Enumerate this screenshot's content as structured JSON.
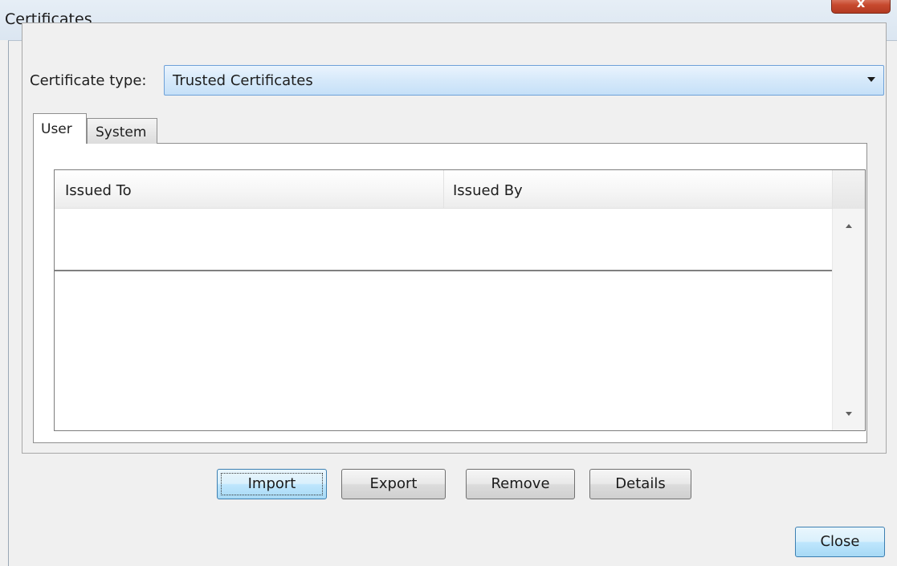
{
  "window": {
    "title": "Certificates",
    "close_glyph": "x"
  },
  "certificate_type": {
    "label": "Certificate type:",
    "selected": "Trusted Certificates"
  },
  "tabs": [
    {
      "label": "User",
      "selected": true
    },
    {
      "label": "System",
      "selected": false
    }
  ],
  "table": {
    "columns": [
      "Issued To",
      "Issued By"
    ],
    "rows": []
  },
  "buttons": {
    "import": "Import",
    "export": "Export",
    "remove": "Remove",
    "details": "Details",
    "close": "Close"
  },
  "colors": {
    "accent_blue": "#6ea1d8",
    "close_red": "#c7492e"
  },
  "icons": {
    "dropdown": "chevron-down-icon",
    "scroll_up": "arrow-up-icon",
    "scroll_down": "arrow-down-icon",
    "window_close": "close-icon"
  }
}
